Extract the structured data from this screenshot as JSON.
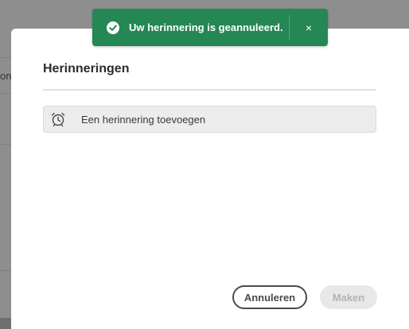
{
  "background": {
    "partial_text": "on"
  },
  "dialog": {
    "title": "Herinneringen",
    "add_reminder_label": "Een herinnering toevoegen",
    "cancel_label": "Annuleren",
    "create_label": "Maken"
  },
  "toast": {
    "message": "Uw herinnering is geannuleerd.",
    "close_glyph": "×",
    "color": "#248754",
    "icon": "checkmark-circle-icon"
  },
  "icons": {
    "add_reminder": "alarm-clock-icon"
  }
}
